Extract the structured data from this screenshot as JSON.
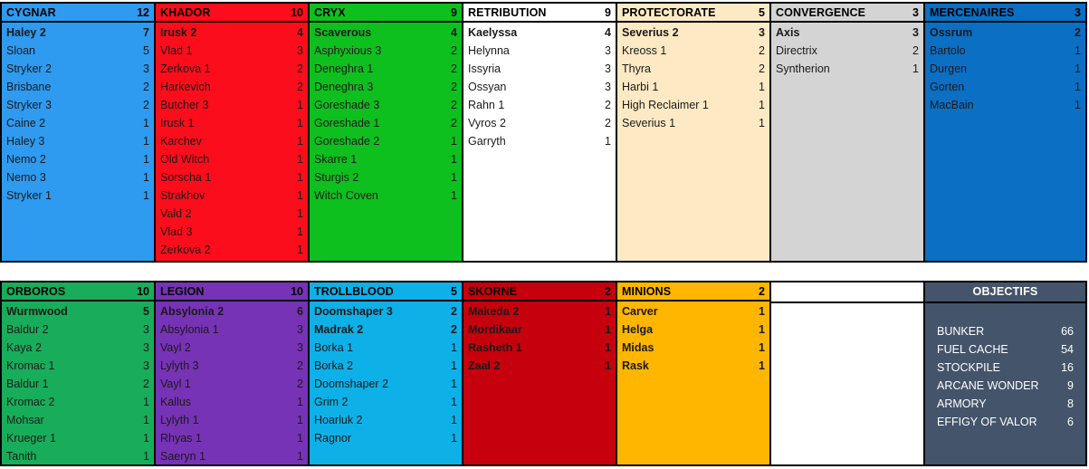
{
  "meta": {
    "top_section_panel_widths": [
      172,
      172,
      172,
      172,
      172,
      172,
      181
    ],
    "bottom_section_panel_widths": [
      172,
      172,
      172,
      172,
      172,
      172,
      181
    ]
  },
  "top_section": [
    {
      "faction": "CYGNAR",
      "count": "12",
      "bg": "#2e9bf0",
      "text": "#1a1a1a",
      "header_text": "#000000",
      "entries": [
        {
          "name": "Haley 2",
          "count": "7"
        },
        {
          "name": "Sloan",
          "count": "5"
        },
        {
          "name": "Stryker 2",
          "count": "3"
        },
        {
          "name": "Brisbane",
          "count": "2"
        },
        {
          "name": "Stryker 3",
          "count": "2"
        },
        {
          "name": "Caine 2",
          "count": "1"
        },
        {
          "name": "Haley 3",
          "count": "1"
        },
        {
          "name": "Nemo 2",
          "count": "1"
        },
        {
          "name": "Nemo 3",
          "count": "1"
        },
        {
          "name": "Stryker 1",
          "count": "1"
        }
      ]
    },
    {
      "faction": "KHADOR",
      "count": "10",
      "bg": "#fc0d1b",
      "text": "#1a1a1a",
      "header_text": "#000000",
      "entries": [
        {
          "name": "Irusk 2",
          "count": "4"
        },
        {
          "name": "Vlad 1",
          "count": "3"
        },
        {
          "name": "Zerkova 1",
          "count": "2"
        },
        {
          "name": "Harkevich",
          "count": "2"
        },
        {
          "name": "Butcher 3",
          "count": "1"
        },
        {
          "name": "Irusk 1",
          "count": "1"
        },
        {
          "name": "Karchev",
          "count": "1"
        },
        {
          "name": "Old Witch",
          "count": "1"
        },
        {
          "name": "Sorscha 1",
          "count": "1"
        },
        {
          "name": "Strakhov",
          "count": "1"
        },
        {
          "name": "Vald 2",
          "count": "1"
        },
        {
          "name": "Vlad 3",
          "count": "1"
        },
        {
          "name": "Zerkova 2",
          "count": "1"
        }
      ]
    },
    {
      "faction": "CRYX",
      "count": "9",
      "bg": "#0ec01e",
      "text": "#1a1a1a",
      "header_text": "#000000",
      "entries": [
        {
          "name": "Scaverous",
          "count": "4"
        },
        {
          "name": "Asphyxious 3",
          "count": "2"
        },
        {
          "name": "Deneghra 1",
          "count": "2"
        },
        {
          "name": "Deneghra 3",
          "count": "2"
        },
        {
          "name": "Goreshade 3",
          "count": "2"
        },
        {
          "name": "Goreshade 1",
          "count": "2"
        },
        {
          "name": "Goreshade 2",
          "count": "1"
        },
        {
          "name": "Skarre 1",
          "count": "1"
        },
        {
          "name": "Sturgis 2",
          "count": "1"
        },
        {
          "name": "Witch Coven",
          "count": "1"
        }
      ]
    },
    {
      "faction": "RETRIBUTION",
      "count": "9",
      "bg": "#ffffff",
      "text": "#1a1a1a",
      "header_text": "#000000",
      "entries": [
        {
          "name": "Kaelyssa",
          "count": "4"
        },
        {
          "name": "Helynna",
          "count": "3"
        },
        {
          "name": "Issyria",
          "count": "3"
        },
        {
          "name": "Ossyan",
          "count": "3"
        },
        {
          "name": "Rahn 1",
          "count": "2"
        },
        {
          "name": "Vyros 2",
          "count": "2"
        },
        {
          "name": "Garryth",
          "count": "1"
        }
      ]
    },
    {
      "faction": "PROTECTORATE",
      "count": "5",
      "bg": "#fdeac4",
      "text": "#1a1a1a",
      "header_text": "#000000",
      "entries": [
        {
          "name": "Severius 2",
          "count": "3"
        },
        {
          "name": "Kreoss 1",
          "count": "2"
        },
        {
          "name": "Thyra",
          "count": "2"
        },
        {
          "name": "Harbi 1",
          "count": "1"
        },
        {
          "name": "High Reclaimer 1",
          "count": "1"
        },
        {
          "name": "Severius 1",
          "count": "1"
        }
      ]
    },
    {
      "faction": "CONVERGENCE",
      "count": "3",
      "bg": "#d4d4d4",
      "text": "#1a1a1a",
      "header_text": "#000000",
      "entries": [
        {
          "name": "Axis",
          "count": "3"
        },
        {
          "name": "Directrix",
          "count": "2"
        },
        {
          "name": "Syntherion",
          "count": "1"
        }
      ]
    },
    {
      "faction": "MERCENAIRES",
      "count": "3",
      "bg": "#0b6fc4",
      "text": "#1a1a1a",
      "header_text": "#000000",
      "entries": [
        {
          "name": "Ossrum",
          "count": "2"
        },
        {
          "name": "Bartolo",
          "count": "1"
        },
        {
          "name": "Durgen",
          "count": "1"
        },
        {
          "name": "Gorten",
          "count": "1"
        },
        {
          "name": "MacBain",
          "count": "1"
        }
      ]
    }
  ],
  "bottom_section": [
    {
      "faction": "ORBOROS",
      "count": "10",
      "bg": "#18ad5a",
      "text": "#1a1a1a",
      "header_text": "#000000",
      "entries": [
        {
          "name": "Wurmwood",
          "count": "5"
        },
        {
          "name": "Baldur 2",
          "count": "3"
        },
        {
          "name": "Kaya 2",
          "count": "3"
        },
        {
          "name": "Kromac 1",
          "count": "3"
        },
        {
          "name": "Baldur 1",
          "count": "2"
        },
        {
          "name": "Kromac 2",
          "count": "1"
        },
        {
          "name": "Mohsar",
          "count": "1"
        },
        {
          "name": "Krueger 1",
          "count": "1"
        },
        {
          "name": "Tanith",
          "count": "1"
        }
      ]
    },
    {
      "faction": "LEGION",
      "count": "10",
      "bg": "#7733b5",
      "text": "#1a1a1a",
      "header_text": "#000000",
      "entries": [
        {
          "name": "Absylonia 2",
          "count": "6"
        },
        {
          "name": "Absylonia 1",
          "count": "3"
        },
        {
          "name": "Vayl 2",
          "count": "3"
        },
        {
          "name": "Lylyth 3",
          "count": "2"
        },
        {
          "name": "Vayl 1",
          "count": "2"
        },
        {
          "name": "Kallus",
          "count": "1"
        },
        {
          "name": "Lylyth 1",
          "count": "1"
        },
        {
          "name": "Rhyas 1",
          "count": "1"
        },
        {
          "name": "Saeryn 1",
          "count": "1"
        }
      ]
    },
    {
      "faction": "TROLLBLOOD",
      "count": "5",
      "bg": "#0eb0e8",
      "text": "#1a1a1a",
      "header_text": "#000000",
      "entries": [
        {
          "name": "Doomshaper 3",
          "count": "2",
          "bold": true
        },
        {
          "name": "Madrak 2",
          "count": "2",
          "bold": true
        },
        {
          "name": "Borka 1",
          "count": "1"
        },
        {
          "name": "Borka 2",
          "count": "1"
        },
        {
          "name": "Doomshaper 2",
          "count": "1"
        },
        {
          "name": "Grim 2",
          "count": "1"
        },
        {
          "name": "Hoarluk 2",
          "count": "1"
        },
        {
          "name": "Ragnor",
          "count": "1"
        }
      ]
    },
    {
      "faction": "SKORNE",
      "count": "2",
      "bg": "#c7000d",
      "text": "#1a1a1a",
      "header_text": "#000000",
      "all_bold": true,
      "entries": [
        {
          "name": "Makeda 2",
          "count": "1"
        },
        {
          "name": "Mordikaar",
          "count": "1"
        },
        {
          "name": "Rasheth 1",
          "count": "1"
        },
        {
          "name": "Zaal 2",
          "count": "1"
        }
      ]
    },
    {
      "faction": "MINIONS",
      "count": "2",
      "bg": "#ffb600",
      "text": "#1a1a1a",
      "header_text": "#000000",
      "all_bold": true,
      "entries": [
        {
          "name": "Carver",
          "count": "1"
        },
        {
          "name": "Helga",
          "count": "1"
        },
        {
          "name": "Midas",
          "count": "1"
        },
        {
          "name": "Rask",
          "count": "1"
        }
      ]
    }
  ],
  "objectives": {
    "title": "OBJECTIFS",
    "bg": "#44546a",
    "text": "#ffffff",
    "entries": [
      {
        "name": "BUNKER",
        "count": "66"
      },
      {
        "name": "FUEL CACHE",
        "count": "54"
      },
      {
        "name": "STOCKPILE",
        "count": "16"
      },
      {
        "name": "ARCANE WONDER",
        "count": "9"
      },
      {
        "name": "ARMORY",
        "count": "8"
      },
      {
        "name": "EFFIGY OF VALOR",
        "count": "6"
      }
    ]
  }
}
